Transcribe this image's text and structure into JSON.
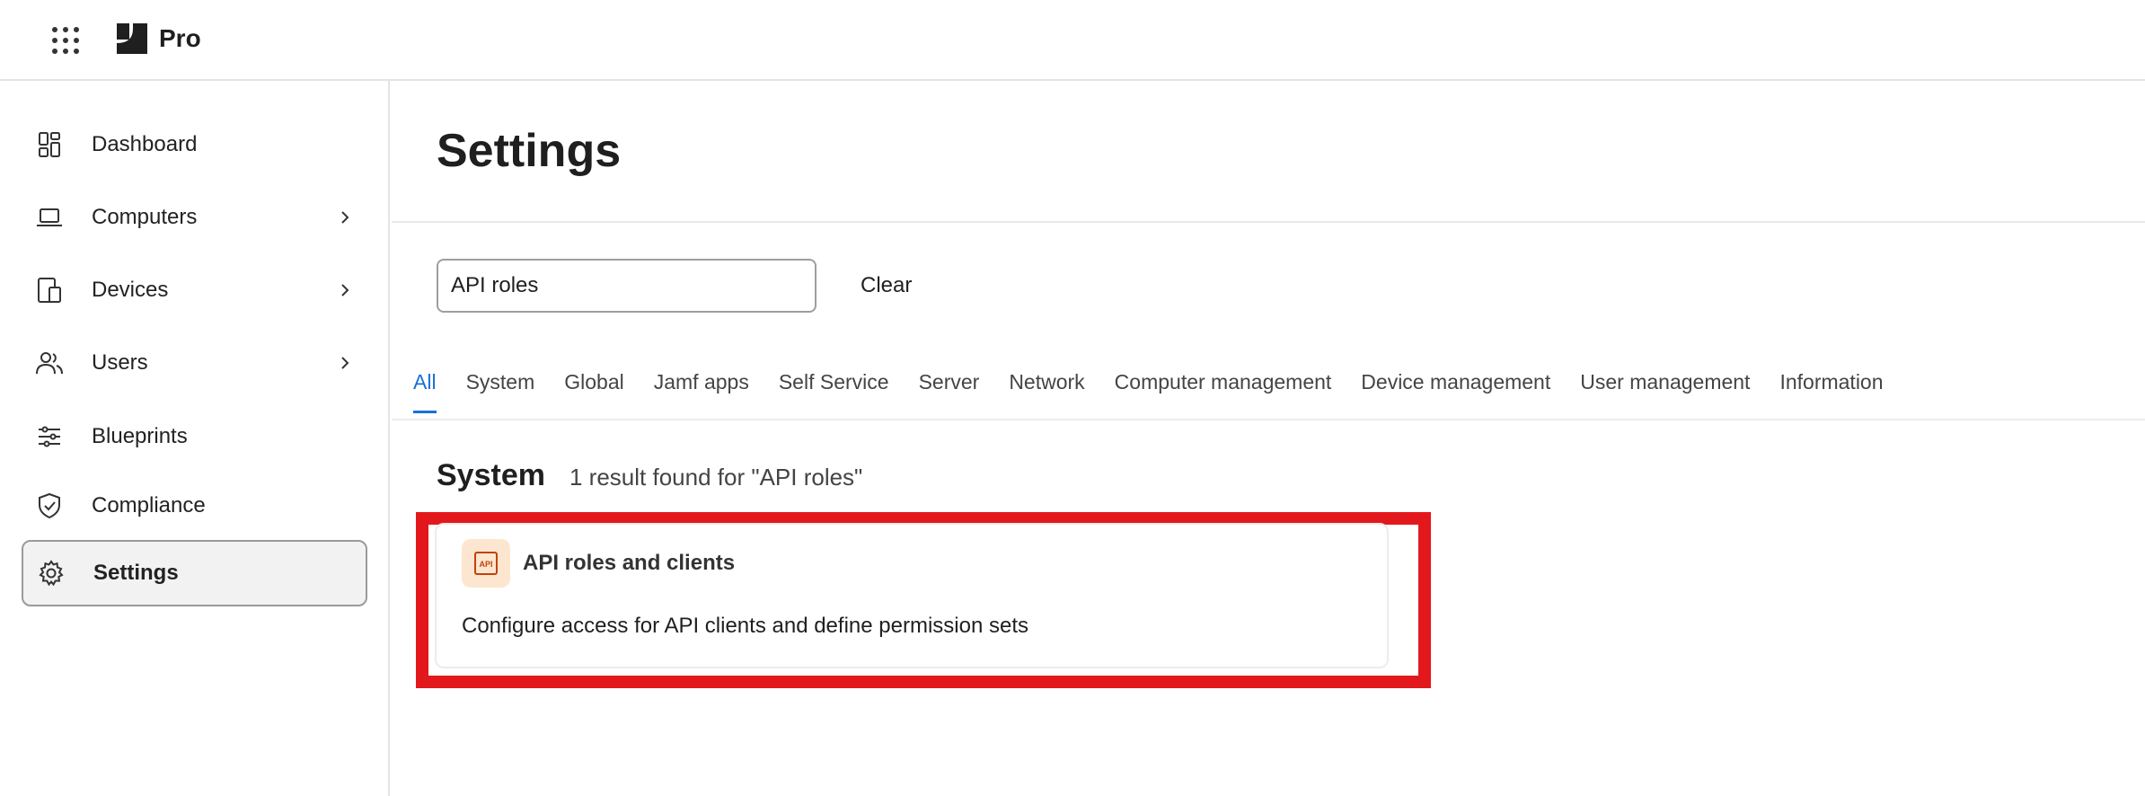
{
  "header": {
    "brand": "Pro"
  },
  "sidebar": {
    "items": [
      {
        "label": "Dashboard",
        "icon": "dashboard-icon",
        "has_chevron": false
      },
      {
        "label": "Computers",
        "icon": "laptop-icon",
        "has_chevron": true
      },
      {
        "label": "Devices",
        "icon": "devices-icon",
        "has_chevron": true
      },
      {
        "label": "Users",
        "icon": "users-icon",
        "has_chevron": true
      },
      {
        "label": "Blueprints",
        "icon": "sliders-icon",
        "has_chevron": false
      },
      {
        "label": "Compliance",
        "icon": "shield-check-icon",
        "has_chevron": false
      },
      {
        "label": "Settings",
        "icon": "gear-icon",
        "has_chevron": false,
        "active": true
      }
    ]
  },
  "main": {
    "title": "Settings",
    "search": {
      "value": "API roles"
    },
    "clear_label": "Clear",
    "tabs": [
      "All",
      "System",
      "Global",
      "Jamf apps",
      "Self Service",
      "Server",
      "Network",
      "Computer management",
      "Device management",
      "User management",
      "Information"
    ],
    "active_tab": "All",
    "section": {
      "title": "System",
      "results_text": "1 result found for \"API roles\"",
      "card": {
        "icon_text": "API",
        "title": "API roles and clients",
        "description": "Configure access for API clients and define permission sets"
      }
    }
  },
  "colors": {
    "accent": "#1a6fd9",
    "highlight": "#e3181c",
    "card_icon_bg": "#fde6cf",
    "card_icon_fg": "#c2410c"
  }
}
